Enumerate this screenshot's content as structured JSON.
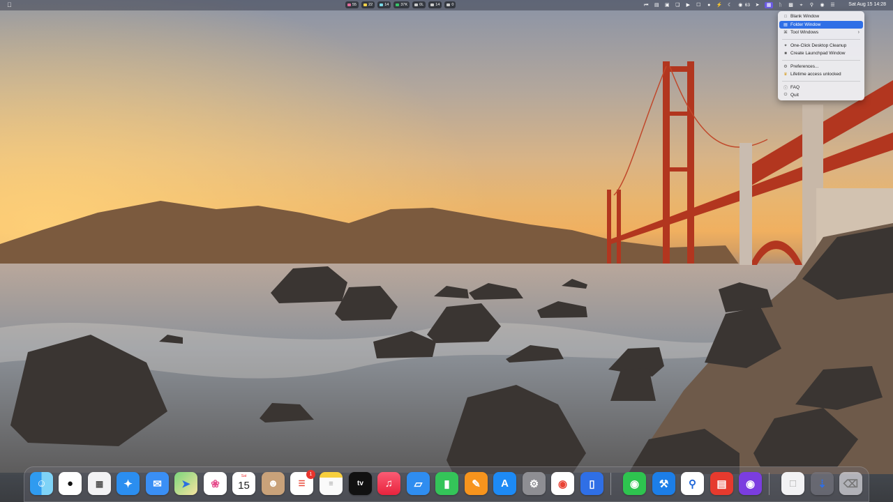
{
  "menubar": {
    "apple_icon": "apple-icon",
    "stats": [
      {
        "label": "55",
        "color": "#e06b9a"
      },
      {
        "label": "22",
        "color": "#f5d24a"
      },
      {
        "label": "14",
        "color": "#7ad9e8"
      },
      {
        "label": "37K",
        "color": "#39c46b"
      },
      {
        "label": "0L",
        "color": "#cccccc"
      },
      {
        "label": "14",
        "color": "#cccccc"
      },
      {
        "label": "0",
        "color": "#cccccc"
      }
    ],
    "wechat_count": "63",
    "datetime": "Sat Aug 15  14:28"
  },
  "dropdown": {
    "items": [
      {
        "label": "Blank Window",
        "icon": "window-icon"
      },
      {
        "label": "Folder Window",
        "icon": "folder-window-icon",
        "selected": true
      },
      {
        "label": "Tool Windows",
        "icon": "tool-window-icon",
        "submenu": true
      },
      {
        "label": "One-Click Desktop Cleanup",
        "icon": "broom-icon"
      },
      {
        "label": "Create Launchpad Window",
        "icon": "grid-icon"
      },
      {
        "label": "Preferences...",
        "icon": "gear-icon"
      },
      {
        "label": "Lifetime access unlocked",
        "icon": "crown-icon"
      },
      {
        "label": "FAQ",
        "icon": "question-icon"
      },
      {
        "label": "Quit",
        "icon": "power-icon"
      }
    ]
  },
  "dock": {
    "calendar": {
      "weekday": "Sat",
      "day": "15"
    },
    "reminders_badge": "1",
    "apps": [
      "Finder",
      "QQ",
      "Launchpad",
      "Safari",
      "Mail",
      "Maps",
      "Photos",
      "Calendar",
      "Contacts",
      "Reminders",
      "Notes",
      "Apple TV",
      "Music",
      "Keynote",
      "Numbers",
      "Pages",
      "App Store",
      "System Settings",
      "Chrome",
      "Reader",
      "WeChat",
      "Xcode",
      "Location",
      "Youdao",
      "Capture",
      "Document",
      "Downloads",
      "Trash"
    ]
  },
  "colors": {
    "menu_selected": "#2f6fe6",
    "accent": "#6a5be0"
  }
}
